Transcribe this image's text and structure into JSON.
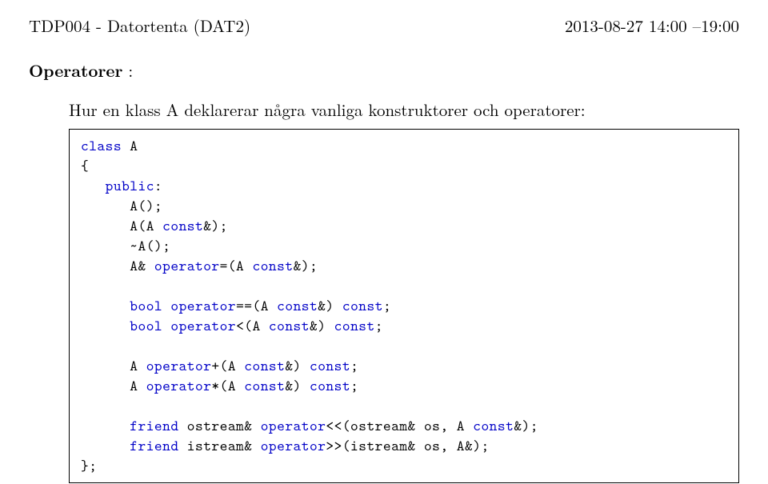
{
  "header": {
    "left": "TDP004 - Datortenta (DAT2)",
    "right": "2013-08-27   14:00 –19:00"
  },
  "section": {
    "label": "Operatorer",
    "colon": " :"
  },
  "intro": "Hur en klass A deklarerar några vanliga konstruktorer och operatorer:",
  "code": {
    "l01a": "class",
    "l01b": " A",
    "l02": "{",
    "l03a": "   ",
    "l03b": "public",
    "l03c": ":",
    "l04": "      A();",
    "l05a": "      A(A ",
    "l05b": "const",
    "l05c": "&);",
    "l06": "      ~A();",
    "l07a": "      A& ",
    "l07b": "operator",
    "l07c": "=(A ",
    "l07d": "const",
    "l07e": "&);",
    "l09a": "      ",
    "l09b": "bool",
    "l09c": " ",
    "l09d": "operator",
    "l09e": "==(A ",
    "l09f": "const",
    "l09g": "&) ",
    "l09h": "const",
    "l09i": ";",
    "l10a": "      ",
    "l10b": "bool",
    "l10c": " ",
    "l10d": "operator",
    "l10e": "<(A ",
    "l10f": "const",
    "l10g": "&) ",
    "l10h": "const",
    "l10i": ";",
    "l12a": "      A ",
    "l12b": "operator",
    "l12c": "+(A ",
    "l12d": "const",
    "l12e": "&) ",
    "l12f": "const",
    "l12g": ";",
    "l13a": "      A ",
    "l13b": "operator",
    "l13c": "*(A ",
    "l13d": "const",
    "l13e": "&) ",
    "l13f": "const",
    "l13g": ";",
    "l15a": "      ",
    "l15b": "friend",
    "l15c": " ostream& ",
    "l15d": "operator",
    "l15e": "<<(ostream& os, A ",
    "l15f": "const",
    "l15g": "&);",
    "l16a": "      ",
    "l16b": "friend",
    "l16c": " istream& ",
    "l16d": "operator",
    "l16e": ">>(istream& os, A&);",
    "l17": "};"
  }
}
